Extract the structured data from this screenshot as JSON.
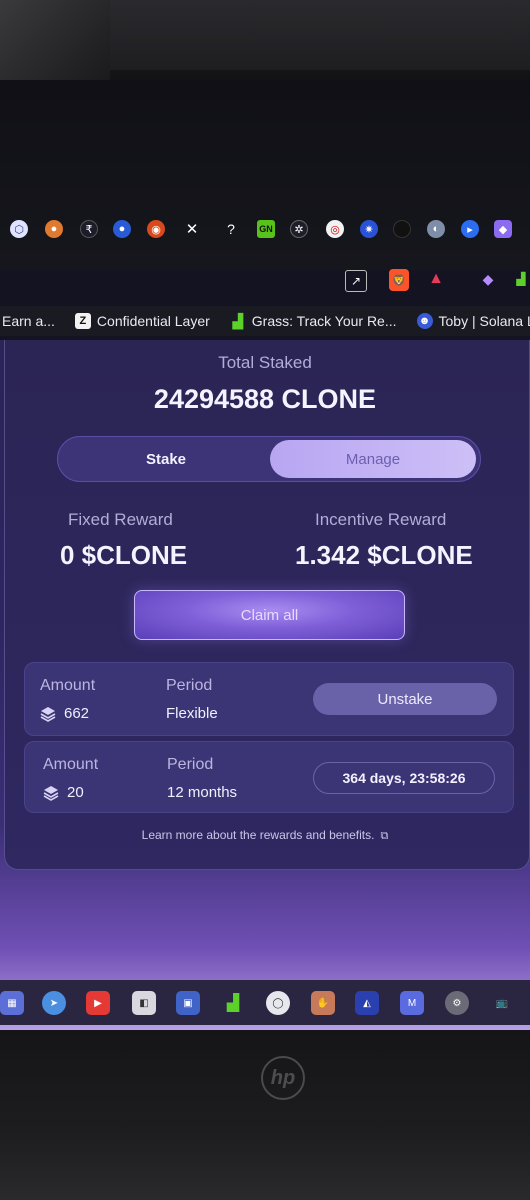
{
  "browser": {
    "bookmarks": [
      {
        "label": "Earn a...",
        "icon": "earn-icon"
      },
      {
        "label": "Confidential Layer",
        "icon": "z-logo-icon"
      },
      {
        "label": "Grass: Track Your Re...",
        "icon": "grass-icon"
      },
      {
        "label": "Toby | Solana Liq",
        "icon": "toby-icon"
      }
    ]
  },
  "staking": {
    "total_label": "Total Staked",
    "total_value": "24294588 CLONE",
    "tabs": {
      "stake": "Stake",
      "manage": "Manage"
    },
    "fixed_reward_label": "Fixed Reward",
    "fixed_reward_value": "0 $CLONE",
    "incentive_reward_label": "Incentive Reward",
    "incentive_reward_value": "1.342 $CLONE",
    "claim_label": "Claim all",
    "positions": [
      {
        "amount_label": "Amount",
        "amount": "662",
        "period_label": "Period",
        "period": "Flexible",
        "action": "Unstake"
      },
      {
        "amount_label": "Amount",
        "amount": "20",
        "period_label": "Period",
        "period": "12 months",
        "countdown": "364 days, 23:58:26"
      }
    ],
    "learn_more": "Learn more about the rewards and benefits."
  },
  "colors": {
    "accent": "#b8a6f2",
    "card_bg": "#2f2861",
    "position_bg": "#3b3575"
  },
  "device": {
    "logo": "hp"
  }
}
